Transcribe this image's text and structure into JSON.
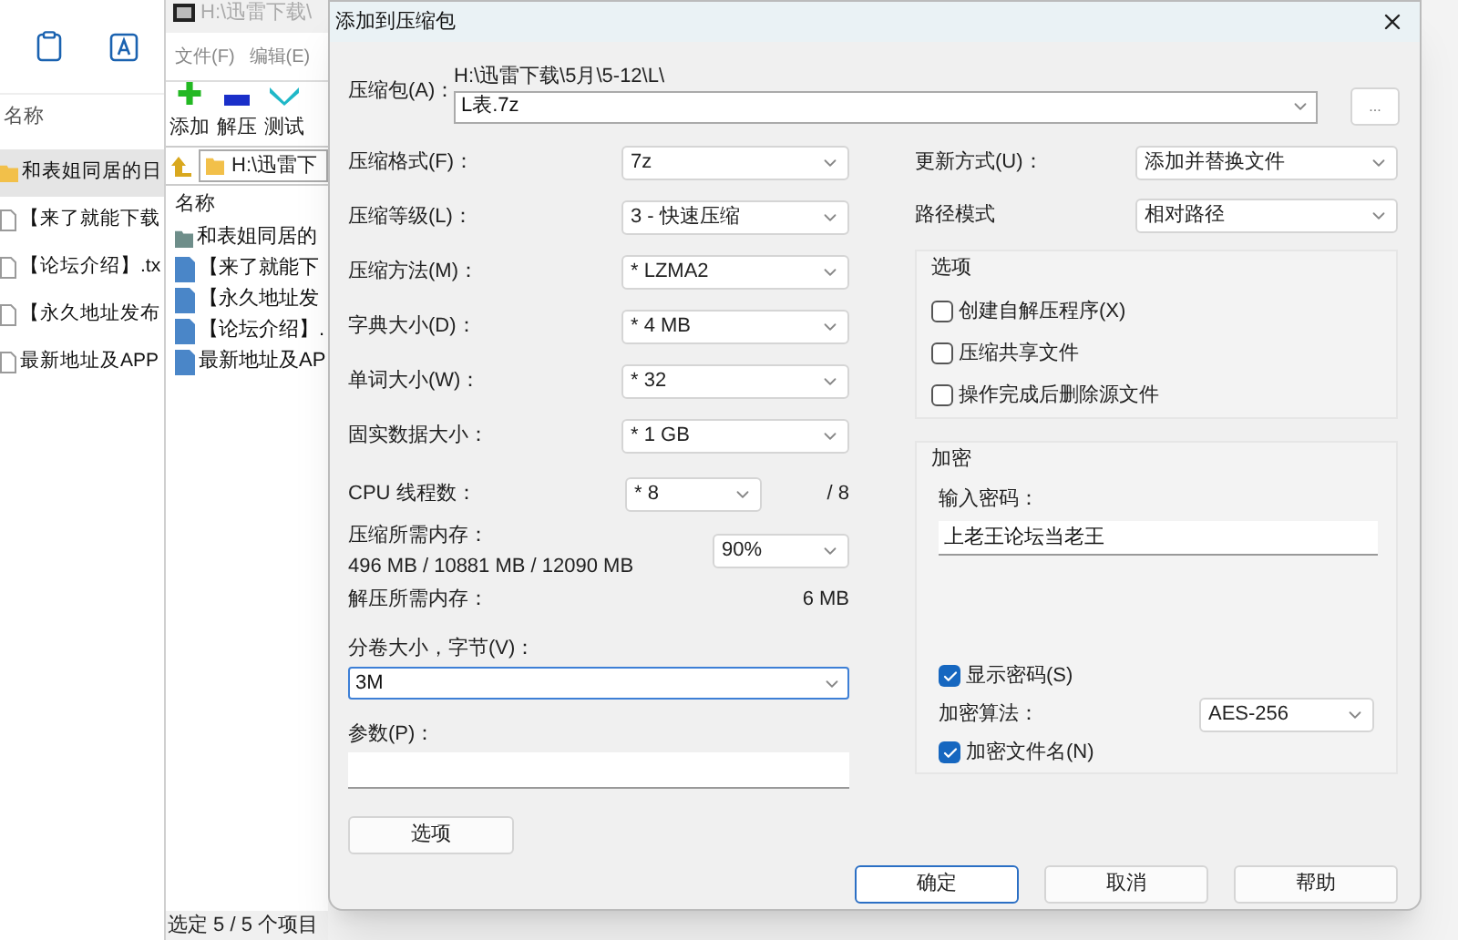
{
  "explorer": {
    "column_header": "名称",
    "items": [
      {
        "name": "和表姐同居的日",
        "kind": "folder",
        "selected": true
      },
      {
        "name": "【来了就能下载",
        "kind": "file",
        "selected": false
      },
      {
        "name": "【论坛介绍】.tx",
        "kind": "file",
        "selected": false
      },
      {
        "name": "【永久地址发布",
        "kind": "file",
        "selected": false
      },
      {
        "name": "最新地址及APP",
        "kind": "file",
        "selected": false
      }
    ]
  },
  "archiver": {
    "title": "H:\\迅雷下载\\",
    "menu": [
      "文件(F)",
      "编辑(E)"
    ],
    "toolbar": [
      {
        "label": "添加",
        "kind": "add"
      },
      {
        "label": "解压",
        "kind": "extract"
      },
      {
        "label": "测试",
        "kind": "test"
      }
    ],
    "path": "H:\\迅雷下",
    "column_header": "名称",
    "items": [
      {
        "name": "和表姐同居的",
        "kind": "folder"
      },
      {
        "name": "【来了就能下",
        "kind": "file"
      },
      {
        "name": "【永久地址发",
        "kind": "file"
      },
      {
        "name": "【论坛介绍】.",
        "kind": "file"
      },
      {
        "name": "最新地址及AP",
        "kind": "file"
      }
    ],
    "status": "选定 5 / 5 个项目"
  },
  "dialog": {
    "title": "添加到压缩包",
    "archive": {
      "label": "压缩包(A)：",
      "folder": "H:\\迅雷下载\\5月\\5-12\\L\\",
      "value": "L表.7z",
      "browse": "..."
    },
    "settings": [
      {
        "label": "压缩格式(F)：",
        "value": "7z"
      },
      {
        "label": "压缩等级(L)：",
        "value": "3 - 快速压缩"
      },
      {
        "label": "压缩方法(M)：",
        "value": "* LZMA2"
      },
      {
        "label": "字典大小(D)：",
        "value": "* 4 MB"
      },
      {
        "label": "单词大小(W)：",
        "value": "* 32"
      },
      {
        "label": "固实数据大小：",
        "value": "* 1 GB"
      }
    ],
    "threads": {
      "label": "CPU 线程数：",
      "value": "* 8",
      "max": "/ 8"
    },
    "memory": {
      "label": "压缩所需内存：",
      "detail": "496 MB / 10881 MB / 12090 MB",
      "value": "90%"
    },
    "decompress_memory": {
      "label": "解压所需内存：",
      "value": "6 MB"
    },
    "volume": {
      "label": "分卷大小，字节(V)：",
      "value": "3M"
    },
    "parameters": {
      "label": "参数(P)："
    },
    "options_button": "选项",
    "update_mode": {
      "label": "更新方式(U)：",
      "value": "添加并替换文件"
    },
    "path_mode": {
      "label": "路径模式",
      "value": "相对路径"
    },
    "options": {
      "title": "选项",
      "items": [
        {
          "label": "创建自解压程序(X)",
          "checked": false
        },
        {
          "label": "压缩共享文件",
          "checked": false
        },
        {
          "label": "操作完成后删除源文件",
          "checked": false
        }
      ]
    },
    "encryption": {
      "title": "加密",
      "password_label": "输入密码：",
      "password": "上老王论坛当老王",
      "show_password": {
        "label": "显示密码(S)",
        "checked": true
      },
      "method": {
        "label": "加密算法：",
        "value": "AES-256"
      },
      "encrypt_names": {
        "label": "加密文件名(N)",
        "checked": true
      }
    },
    "buttons": [
      {
        "label": "确定",
        "kind": "default"
      },
      {
        "label": "取消",
        "kind": "normal"
      },
      {
        "label": "帮助",
        "kind": "normal"
      }
    ]
  }
}
